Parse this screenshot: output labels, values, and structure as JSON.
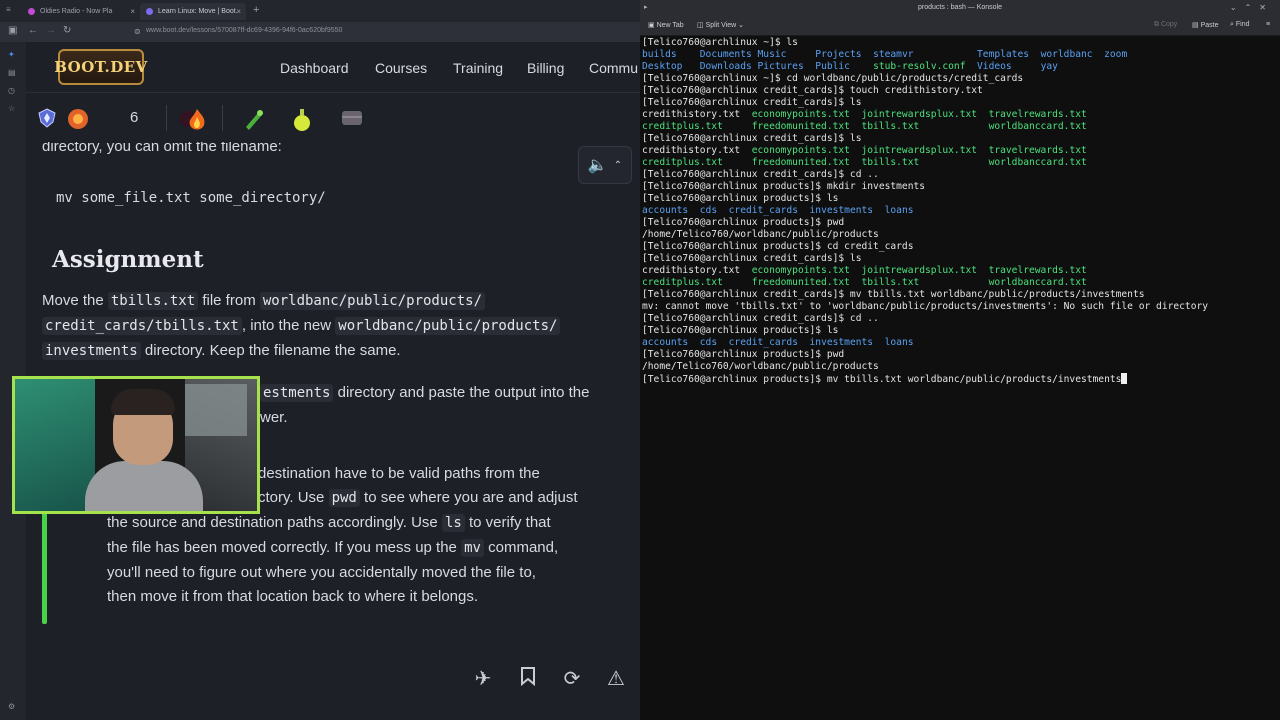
{
  "browser": {
    "tabs": [
      {
        "title": "Oldies Radio - Now Pla",
        "icon": "radio-icon",
        "active": false
      },
      {
        "title": "Learn Linux: Move | Boot.",
        "icon": "bootdev-favicon",
        "active": true
      }
    ],
    "url": "www.boot.dev/lessons/570087ff-dc69-4396-94f6-0ac620bf9550"
  },
  "site": {
    "logo_text": "BOOT.DEV",
    "nav": [
      "Dashboard",
      "Courses",
      "Training",
      "Billing",
      "Commu"
    ],
    "stats": {
      "streak_count": "6"
    }
  },
  "lesson": {
    "intro_line": "directory, you can omit the filename:",
    "code_example": "mv some_file.txt some_directory/",
    "heading": "Assignment",
    "p1": {
      "a": "Move the",
      "code1": "tbills.txt",
      "b": "file from",
      "code2a": "worldbanc/public/products/",
      "code2b": "credit_cards/tbills.txt",
      "c": ", into the new",
      "code3a": "worldbanc/public/products/",
      "code3b": "investments",
      "d": "directory. Keep the filename the same."
    },
    "p2": {
      "code_tail": "estments",
      "a": "directory and paste the output into the",
      "b": "wer."
    },
    "tip": {
      "line1": "destination have to be valid paths from the",
      "line2a": "ctory. Use",
      "code_pwd": "pwd",
      "line2b": "to see where you are and adjust",
      "line3a": "the source and destination paths accordingly. Use",
      "code_ls": "ls",
      "line3b": "to verify that",
      "line4a": "the file has been moved correctly. If you mess up the",
      "code_mv": "mv",
      "line4b": "command,",
      "line5": "you'll need to figure out where you accidentally moved the file to,",
      "line6": "then move it from that location back to where it belongs."
    }
  },
  "konsole": {
    "title": "products : bash — Konsole",
    "toolbar": {
      "new_tab": "New Tab",
      "split_view": "Split View",
      "copy": "Copy",
      "paste": "Paste",
      "find": "Find"
    },
    "lines": [
      [
        {
          "t": "[Telico760@archlinux ~]$ ls"
        }
      ],
      [
        {
          "t": "builds    ",
          "c": "dir"
        },
        {
          "t": "Documents ",
          "c": "dir"
        },
        {
          "t": "Music     ",
          "c": "dir"
        },
        {
          "t": "Projects  ",
          "c": "dir"
        },
        {
          "t": "steamvr           ",
          "c": "dir"
        },
        {
          "t": "Templates  ",
          "c": "dir"
        },
        {
          "t": "worldbanc  ",
          "c": "dir"
        },
        {
          "t": "zoom",
          "c": "dir"
        }
      ],
      [
        {
          "t": "Desktop   ",
          "c": "dir"
        },
        {
          "t": "Downloads ",
          "c": "dir"
        },
        {
          "t": "Pictures  ",
          "c": "dir"
        },
        {
          "t": "Public    ",
          "c": "dir"
        },
        {
          "t": "stub-resolv.conf  ",
          "c": "exe"
        },
        {
          "t": "Videos     ",
          "c": "dir"
        },
        {
          "t": "yay",
          "c": "dir"
        }
      ],
      [
        {
          "t": "[Telico760@archlinux ~]$ cd worldbanc/public/products/credit_cards"
        }
      ],
      [
        {
          "t": "[Telico760@archlinux credit_cards]$ touch credithistory.txt"
        }
      ],
      [
        {
          "t": "[Telico760@archlinux credit_cards]$ ls"
        }
      ],
      [
        {
          "t": "credithistory.txt  "
        },
        {
          "t": "economypoints.txt  ",
          "c": "exe"
        },
        {
          "t": "jointrewardsplux.txt  ",
          "c": "exe"
        },
        {
          "t": "travelrewards.txt",
          "c": "exe"
        }
      ],
      [
        {
          "t": "creditplus.txt     ",
          "c": "exe"
        },
        {
          "t": "freedomunited.txt  ",
          "c": "exe"
        },
        {
          "t": "tbills.txt            ",
          "c": "exe"
        },
        {
          "t": "worldbanccard.txt",
          "c": "exe"
        }
      ],
      [
        {
          "t": "[Telico760@archlinux credit_cards]$ ls"
        }
      ],
      [
        {
          "t": "credithistory.txt  "
        },
        {
          "t": "economypoints.txt  ",
          "c": "exe"
        },
        {
          "t": "jointrewardsplux.txt  ",
          "c": "exe"
        },
        {
          "t": "travelrewards.txt",
          "c": "exe"
        }
      ],
      [
        {
          "t": "creditplus.txt     ",
          "c": "exe"
        },
        {
          "t": "freedomunited.txt  ",
          "c": "exe"
        },
        {
          "t": "tbills.txt            ",
          "c": "exe"
        },
        {
          "t": "worldbanccard.txt",
          "c": "exe"
        }
      ],
      [
        {
          "t": "[Telico760@archlinux credit_cards]$ cd .."
        }
      ],
      [
        {
          "t": "[Telico760@archlinux products]$ mkdir investments"
        }
      ],
      [
        {
          "t": "[Telico760@archlinux products]$ ls"
        }
      ],
      [
        {
          "t": "accounts  ",
          "c": "dir"
        },
        {
          "t": "cds  ",
          "c": "dir"
        },
        {
          "t": "credit_cards  ",
          "c": "dir"
        },
        {
          "t": "investments  ",
          "c": "dir"
        },
        {
          "t": "loans",
          "c": "dir"
        }
      ],
      [
        {
          "t": "[Telico760@archlinux products]$ pwd"
        }
      ],
      [
        {
          "t": "/home/Telico760/worldbanc/public/products"
        }
      ],
      [
        {
          "t": "[Telico760@archlinux products]$ cd credit_cards"
        }
      ],
      [
        {
          "t": "[Telico760@archlinux credit_cards]$ ls"
        }
      ],
      [
        {
          "t": "credithistory.txt  "
        },
        {
          "t": "economypoints.txt  ",
          "c": "exe"
        },
        {
          "t": "jointrewardsplux.txt  ",
          "c": "exe"
        },
        {
          "t": "travelrewards.txt",
          "c": "exe"
        }
      ],
      [
        {
          "t": "creditplus.txt     ",
          "c": "exe"
        },
        {
          "t": "freedomunited.txt  ",
          "c": "exe"
        },
        {
          "t": "tbills.txt            ",
          "c": "exe"
        },
        {
          "t": "worldbanccard.txt",
          "c": "exe"
        }
      ],
      [
        {
          "t": "[Telico760@archlinux credit_cards]$ mv tbills.txt worldbanc/public/products/investments"
        }
      ],
      [
        {
          "t": "mv: cannot move 'tbills.txt' to 'worldbanc/public/products/investments': No such file or directory"
        }
      ],
      [
        {
          "t": "[Telico760@archlinux credit_cards]$ cd .."
        }
      ],
      [
        {
          "t": "[Telico760@archlinux products]$ ls"
        }
      ],
      [
        {
          "t": "accounts  ",
          "c": "dir"
        },
        {
          "t": "cds  ",
          "c": "dir"
        },
        {
          "t": "credit_cards  ",
          "c": "dir"
        },
        {
          "t": "investments  ",
          "c": "dir"
        },
        {
          "t": "loans",
          "c": "dir"
        }
      ],
      [
        {
          "t": "[Telico760@archlinux products]$ pwd"
        }
      ],
      [
        {
          "t": "/home/Telico760/worldbanc/public/products"
        }
      ],
      [
        {
          "t": "[Telico760@archlinux products]$ mv tbills.txt worldbanc/public/products/investments",
          "cursor": true
        }
      ]
    ]
  },
  "colors": {
    "dir": "#5aa0f0",
    "exe": "#4de07c",
    "accent_green": "#4ad049",
    "cam_border": "#a6e24c"
  }
}
